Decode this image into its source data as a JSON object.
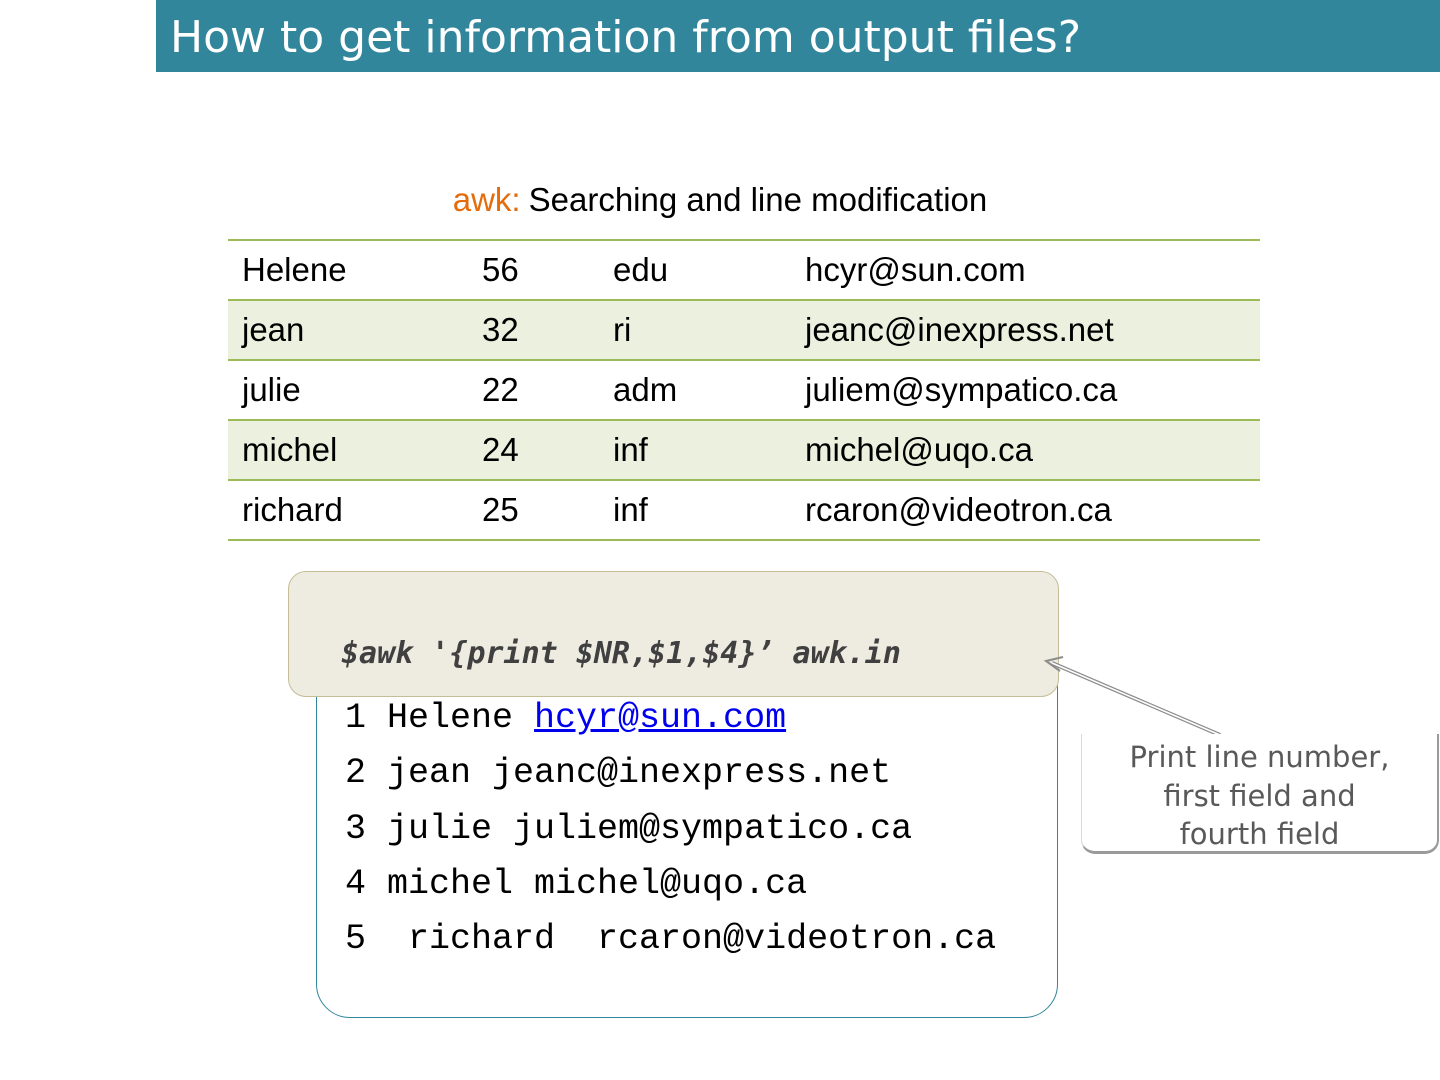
{
  "title": "How to get information from output files?",
  "subtitle": {
    "keyword": "awk:",
    "text": "Searching and line modification"
  },
  "table": {
    "rows": [
      [
        "Helene",
        "56",
        "edu",
        "hcyr@sun.com"
      ],
      [
        "jean",
        "32",
        "ri",
        "jeanc@inexpress.net"
      ],
      [
        "julie",
        "22",
        "adm",
        "juliem@sympatico.ca"
      ],
      [
        "michel",
        "24",
        "inf",
        "michel@uqo.ca"
      ],
      [
        "richard",
        "25",
        "inf",
        "rcaron@videotron.ca"
      ]
    ]
  },
  "command": "$awk '{print $NR,$1,$4}’ awk.in",
  "output": {
    "lines": [
      {
        "prefix": "1 Helene ",
        "email": "hcyr@sun.com"
      },
      {
        "text": "2 jean jeanc@inexpress.net"
      },
      {
        "text": "3 julie juliem@sympatico.ca"
      },
      {
        "text": "4 michel michel@uqo.ca"
      },
      {
        "text": "5  richard  rcaron@videotron.ca"
      }
    ]
  },
  "callout": {
    "lines": [
      "Print line number,",
      "first field and",
      "fourth field"
    ]
  },
  "colors": {
    "title_bar": "#31869b",
    "keyword": "#e46c0a",
    "table_rule": "#9bbb59",
    "table_shade": "#ebf1de",
    "command_bg": "#eeece1",
    "link": "#0000ee"
  }
}
